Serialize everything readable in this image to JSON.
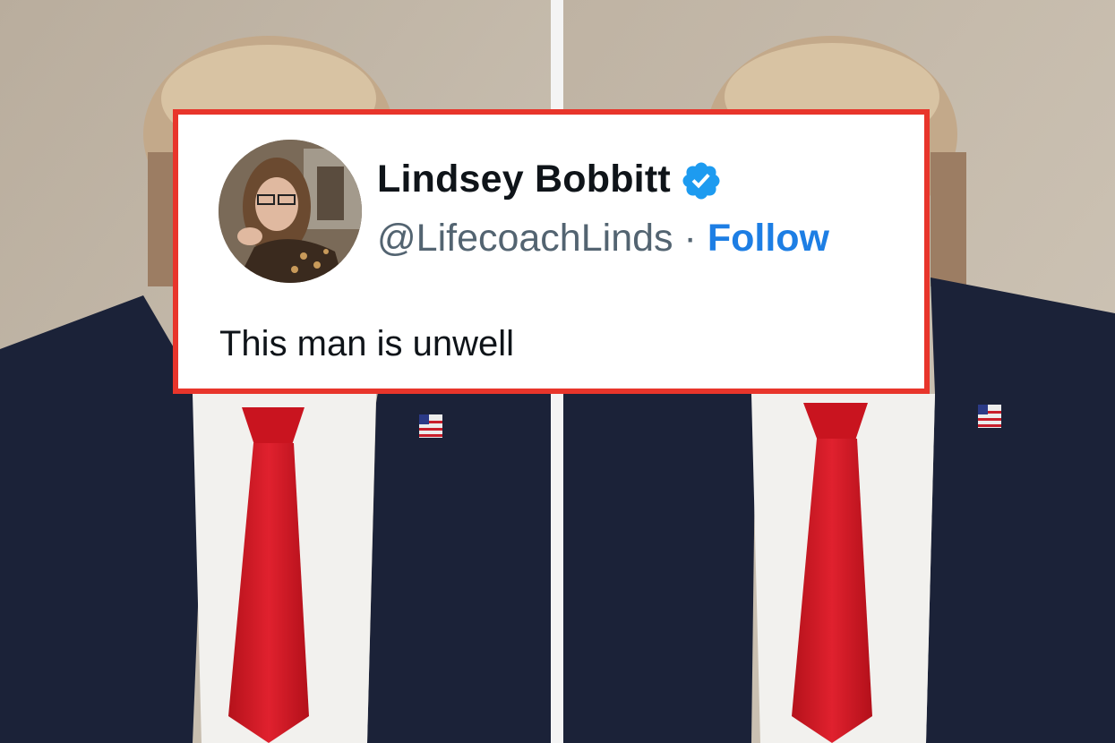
{
  "tweet": {
    "display_name": "Lindsey Bobbitt",
    "handle": "@LifecoachLinds",
    "separator": "·",
    "follow_label": "Follow",
    "text": "This man is unwell",
    "verified": true
  },
  "colors": {
    "frame_border": "#e8352b",
    "follow_link": "#1d7ee4",
    "verified_badge": "#1d9bf0",
    "name_text": "#0f1419",
    "handle_text": "#536471"
  },
  "icons": {
    "verified": "verified-badge-icon",
    "avatar": "profile-avatar"
  }
}
